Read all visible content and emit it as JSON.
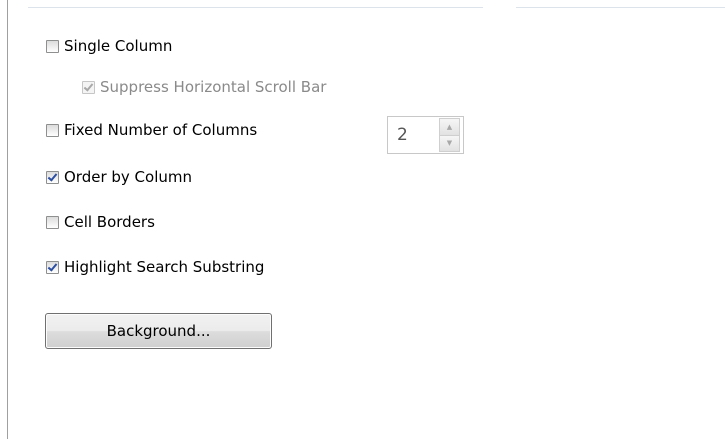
{
  "options": {
    "single_column": {
      "label": "Single Column",
      "checked": false,
      "enabled": true
    },
    "suppress_horizontal_scroll_bar": {
      "label": "Suppress Horizontal Scroll Bar",
      "checked": true,
      "enabled": false
    },
    "fixed_number_of_columns": {
      "label": "Fixed Number of Columns",
      "checked": false,
      "enabled": true
    },
    "order_by_column": {
      "label": "Order by Column",
      "checked": true,
      "enabled": true
    },
    "cell_borders": {
      "label": "Cell Borders",
      "checked": false,
      "enabled": true
    },
    "highlight_search_substring": {
      "label": "Highlight Search Substring",
      "checked": true,
      "enabled": true
    }
  },
  "columns_spinner": {
    "value": "2",
    "enabled": false,
    "up_icon": "triangle-up",
    "down_icon": "triangle-down"
  },
  "background_button": {
    "label": "Background..."
  },
  "colors": {
    "check_mark": "#2a4ea2",
    "disabled_text": "#8a8a8a"
  }
}
